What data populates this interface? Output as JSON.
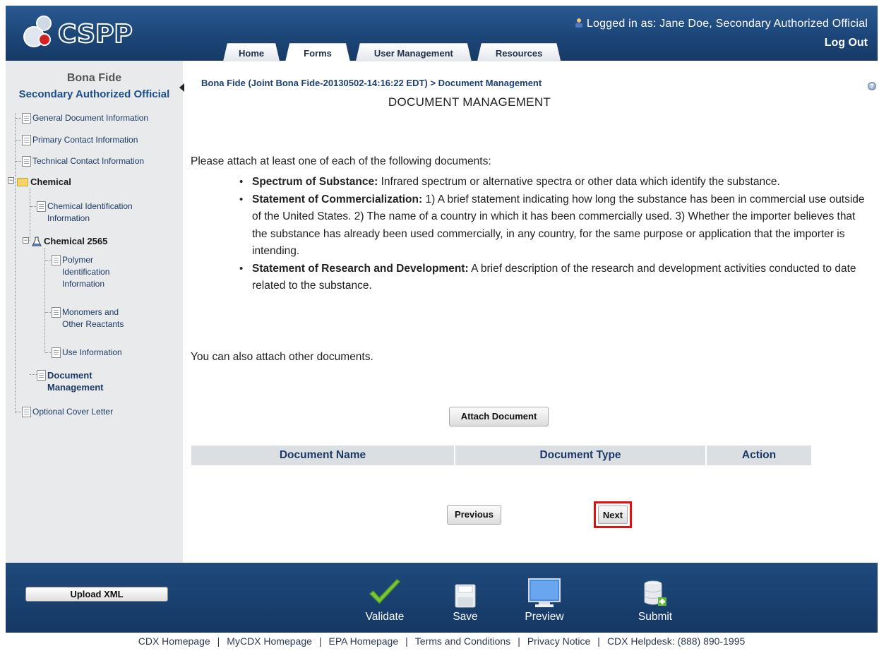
{
  "app": {
    "logo_text": "CSPP",
    "user_line": "Logged in as: Jane Doe, Secondary Authorized Official",
    "logout": "Log Out",
    "tabs": [
      {
        "label": "Home"
      },
      {
        "label": "Forms",
        "active": true
      },
      {
        "label": "User Management"
      },
      {
        "label": "Resources"
      }
    ]
  },
  "sidebar": {
    "title": "Bona Fide",
    "role": "Secondary Authorized Official",
    "items": {
      "general": "General Document Information",
      "primary": "Primary Contact Information",
      "technical": "Technical Contact Information",
      "chemical": "Chemical",
      "chem_id_1": "Chemical Identification",
      "chem_id_2": "Information",
      "chemical_2565": "Chemical 2565",
      "polymer_1": "Polymer",
      "polymer_2": "Identification",
      "polymer_3": "Information",
      "monomers_1": "Monomers and",
      "monomers_2": "Other Reactants",
      "use": "Use Information",
      "docmgmt_1": "Document",
      "docmgmt_2": "Management",
      "cover": "Optional Cover Letter"
    }
  },
  "main": {
    "breadcrumb": "Bona Fide (Joint Bona Fide-20130502-14:16:22 EDT) > Document Management",
    "title": "DOCUMENT MANAGEMENT",
    "intro": "Please attach at least one of each of the following documents:",
    "bullets": [
      {
        "head": "Spectrum of Substance:",
        "text": " Infrared spectrum or alternative spectra or other data which identify the substance."
      },
      {
        "head": "Statement of Commercialization:",
        "text": " 1) A brief statement indicating how long the substance has been in commercial use outside of the United States. 2) The name of a country in which it has been commercially used. 3) Whether the importer believes that the substance has already been used commercially, in any country, for the same purpose or application that the importer is intending."
      },
      {
        "head": "Statement of Research and Development:",
        "text": " A brief description of the research and development activities conducted to date related to the substance."
      }
    ],
    "also": "You can also attach other documents.",
    "attach_button": "Attach Document",
    "table_headers": {
      "name": "Document Name",
      "type": "Document Type",
      "action": "Action"
    },
    "previous_button": "Previous",
    "next_button": "Next"
  },
  "bottom_bar": {
    "upload": "Upload XML",
    "validate": "Validate",
    "save": "Save",
    "preview": "Preview",
    "submit": "Submit"
  },
  "footer": {
    "links": [
      "CDX Homepage",
      "MyCDX Homepage",
      "EPA Homepage",
      "Terms and Conditions",
      "Privacy Notice",
      "CDX Helpdesk: (888) 890-1995"
    ]
  },
  "colors": {
    "header_blue": "#1c4678",
    "sidebar_bg": "#e8eaeb",
    "highlight_red": "#e01010"
  }
}
